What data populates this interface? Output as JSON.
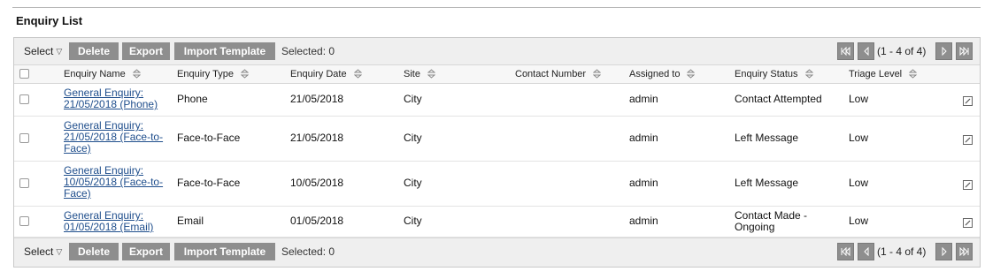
{
  "panel": {
    "title": "Enquiry List"
  },
  "toolbar": {
    "select_label": "Select",
    "delete_label": "Delete",
    "export_label": "Export",
    "import_label": "Import Template",
    "selected_text": "Selected: 0",
    "pager_info": "(1 - 4 of 4)"
  },
  "columns": {
    "name": "Enquiry Name",
    "type": "Enquiry Type",
    "date": "Enquiry Date",
    "site": "Site",
    "contact": "Contact Number",
    "assigned": "Assigned to",
    "status": "Enquiry Status",
    "triage": "Triage Level"
  },
  "rows": [
    {
      "name": "General Enquiry: 21/05/2018 (Phone)",
      "type": "Phone",
      "date": "21/05/2018",
      "site": "City",
      "contact": "",
      "assigned": "admin",
      "status": "Contact Attempted",
      "triage": "Low"
    },
    {
      "name": "General Enquiry: 21/05/2018 (Face-to-Face)",
      "type": "Face-to-Face",
      "date": "21/05/2018",
      "site": "City",
      "contact": "",
      "assigned": "admin",
      "status": "Left Message",
      "triage": "Low"
    },
    {
      "name": "General Enquiry: 10/05/2018 (Face-to-Face)",
      "type": "Face-to-Face",
      "date": "10/05/2018",
      "site": "City",
      "contact": "",
      "assigned": "admin",
      "status": "Left Message",
      "triage": "Low"
    },
    {
      "name": "General Enquiry: 01/05/2018 (Email)",
      "type": "Email",
      "date": "01/05/2018",
      "site": "City",
      "contact": "",
      "assigned": "admin",
      "status": "Contact Made - Ongoing",
      "triage": "Low"
    }
  ],
  "icons": {
    "first": "first-page-icon",
    "prev": "prev-page-icon",
    "next": "next-page-icon",
    "last": "last-page-icon",
    "sort": "sort-icon",
    "edit": "edit-icon"
  },
  "colors": {
    "button_bg": "#8e8e8e",
    "link": "#1f4e8c",
    "bar_bg": "#efefef"
  }
}
